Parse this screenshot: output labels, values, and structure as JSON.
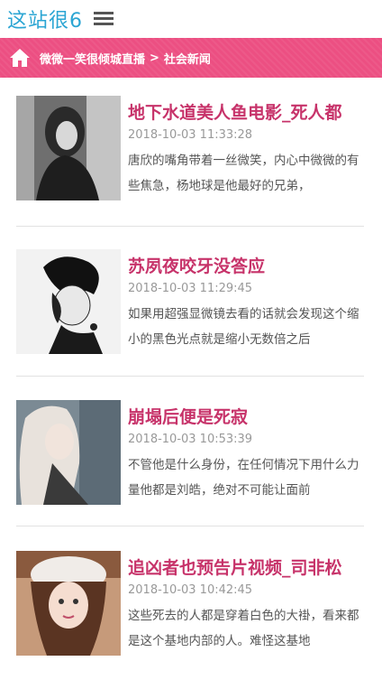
{
  "header": {
    "logo": "这站很6",
    "menu_icon": "hamburger-menu-icon"
  },
  "breadcrumb": {
    "home_icon": "home-icon",
    "section": "微微一笑很倾城直播",
    "separator": ">",
    "current": "社会新闻"
  },
  "colors": {
    "accent": "#ec4f82",
    "title": "#c7336a",
    "logo": "#2ba5d3"
  },
  "articles": [
    {
      "title": "地下水道美人鱼电影_死人都",
      "date": "2018-10-03 11:33:28",
      "excerpt": "唐欣的嘴角带着一丝微笑，内心中微微的有些焦急，杨地球是他最好的兄弟，"
    },
    {
      "title": "苏夙夜咬牙没答应",
      "date": "2018-10-03 11:29:45",
      "excerpt": "如果用超强显微镜去看的话就会发现这个缩小的黑色光点就是缩小无数倍之后"
    },
    {
      "title": "崩塌后便是死寂",
      "date": "2018-10-03 10:53:39",
      "excerpt": "不管他是什么身份，在任何情况下用什么力量他都是刘皓，绝对不可能让面前"
    },
    {
      "title": "追凶者也预告片视频_司非松",
      "date": "2018-10-03 10:42:45",
      "excerpt": "这些死去的人都是穿着白色的大褂，看来都是这个基地内部的人。难怪这基地"
    }
  ]
}
